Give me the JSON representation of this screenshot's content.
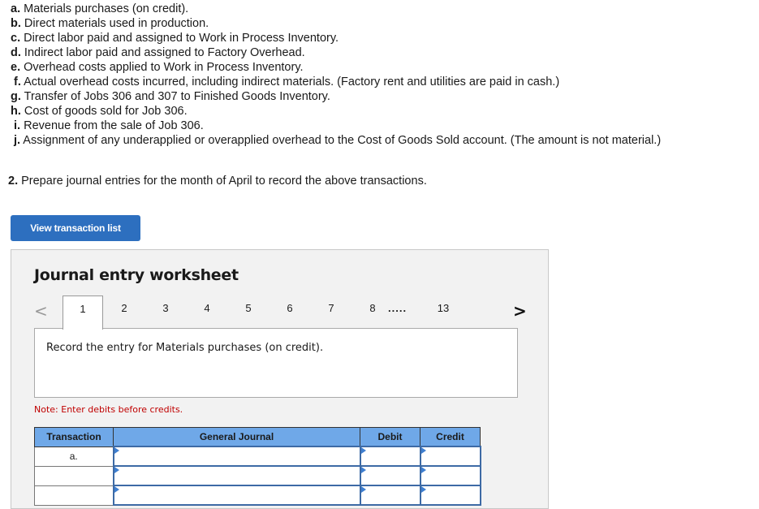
{
  "transactions": [
    {
      "letter": "a.",
      "text": " Materials purchases (on credit)."
    },
    {
      "letter": "b.",
      "text": " Direct materials used in production."
    },
    {
      "letter": "c.",
      "text": " Direct labor paid and assigned to Work in Process Inventory."
    },
    {
      "letter": "d.",
      "text": " Indirect labor paid and assigned to Factory Overhead."
    },
    {
      "letter": "e.",
      "text": " Overhead costs applied to Work in Process Inventory."
    },
    {
      "letter": "f.",
      "text": " Actual overhead costs incurred, including indirect materials. (Factory rent and utilities are paid in cash.)"
    },
    {
      "letter": "g.",
      "text": " Transfer of Jobs 306 and 307 to Finished Goods Inventory."
    },
    {
      "letter": "h.",
      "text": " Cost of goods sold for Job 306."
    },
    {
      "letter": "i.",
      "text": " Revenue from the sale of Job 306."
    },
    {
      "letter": "j.",
      "text": " Assignment of any underapplied or overapplied overhead to the Cost of Goods Sold account. (The amount is not material.)"
    }
  ],
  "prompt": {
    "number": "2.",
    "text": " Prepare journal entries for the month of April to record the above transactions."
  },
  "view_button_label": "View transaction list",
  "worksheet": {
    "title": "Journal entry worksheet",
    "prev_icon": "chevron-left-icon",
    "next_icon": "chevron-right-icon",
    "prev_glyph": "<",
    "next_glyph": ">",
    "tabs": [
      "1",
      "2",
      "3",
      "4",
      "5",
      "6",
      "7",
      "8"
    ],
    "ellipsis": ".....",
    "last_tab": "13",
    "active_tab": "1",
    "instruction": "Record the entry for Materials purchases (on credit).",
    "note": "Note: Enter debits before credits."
  },
  "journal_table": {
    "headers": {
      "transaction": "Transaction",
      "general_journal": "General Journal",
      "debit": "Debit",
      "credit": "Credit"
    },
    "rows": [
      {
        "transaction": "a.",
        "account": "",
        "debit": "",
        "credit": ""
      },
      {
        "transaction": "",
        "account": "",
        "debit": "",
        "credit": ""
      },
      {
        "transaction": "",
        "account": "",
        "debit": "",
        "credit": ""
      }
    ]
  }
}
